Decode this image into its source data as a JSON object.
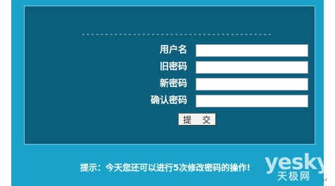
{
  "form": {
    "divider": "-------------------------------------------",
    "fields": [
      {
        "label": "用户名",
        "value": ""
      },
      {
        "label": "旧密码",
        "value": ""
      },
      {
        "label": "新密码",
        "value": ""
      },
      {
        "label": "确认密码",
        "value": ""
      }
    ],
    "submit_label": "提 交"
  },
  "hint": {
    "text": "提示：今天您还可以进行5次修改密码的操作!"
  },
  "watermark": {
    "brand": "yesky",
    "chinese": "天极网"
  },
  "colors": {
    "frame": "#1aa3c8",
    "panel": "#0b5f7a",
    "text": "#ffffff"
  }
}
